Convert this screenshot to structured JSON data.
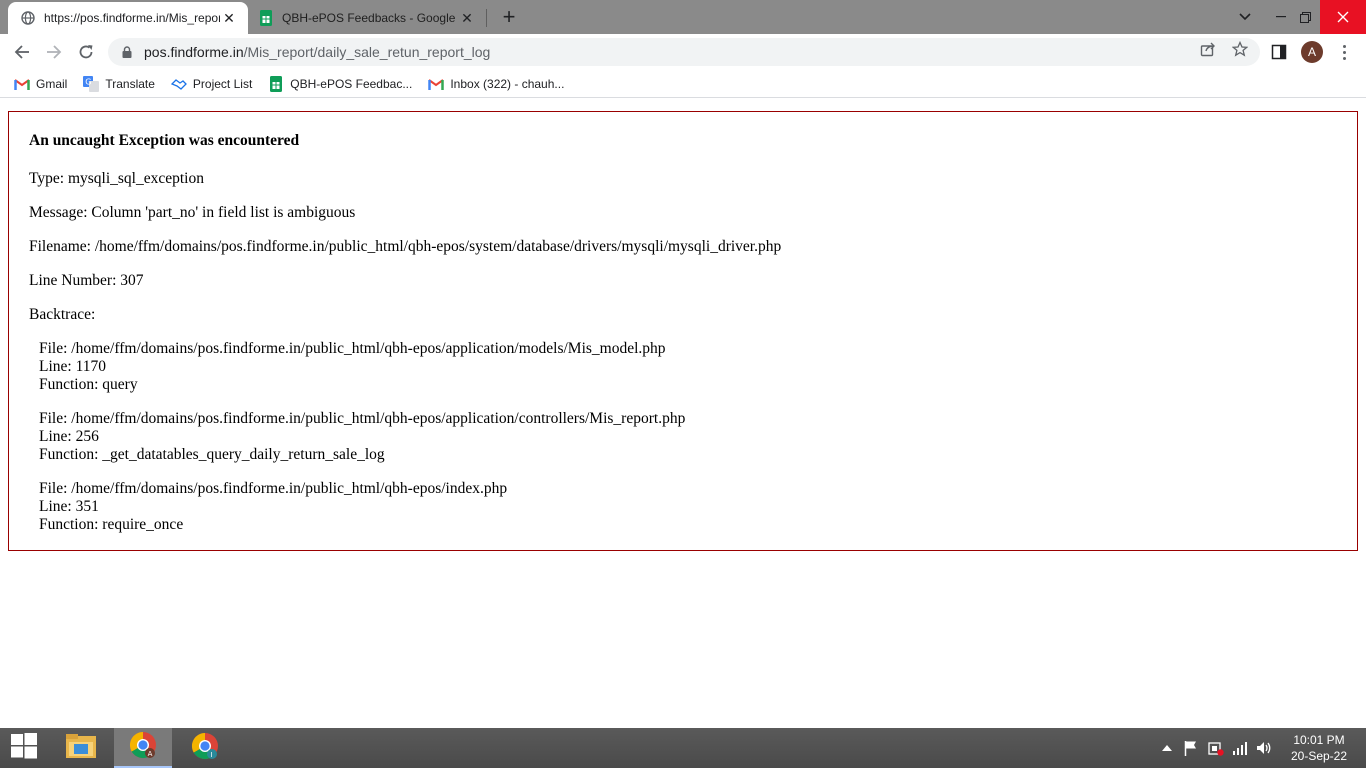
{
  "browser": {
    "tabs": [
      {
        "title": "https://pos.findforme.in/Mis_report/daily_sale_retun_report_log",
        "active": true,
        "favicon": "globe-icon"
      },
      {
        "title": "QBH-ePOS Feedbacks - Google Sheets",
        "active": false,
        "favicon": "google-sheets-icon"
      }
    ],
    "address_bar": {
      "host": "pos.findforme.in",
      "path": "/Mis_report/daily_sale_retun_report_log"
    },
    "profile_initial": "A",
    "bookmarks": [
      {
        "label": "Gmail",
        "icon": "gmail-icon"
      },
      {
        "label": "Translate",
        "icon": "translate-icon"
      },
      {
        "label": "Project List",
        "icon": "handshake-icon"
      },
      {
        "label": "QBH-ePOS Feedbac...",
        "icon": "google-sheets-icon"
      },
      {
        "label": "Inbox (322) - chauh...",
        "icon": "gmail-icon"
      }
    ]
  },
  "error": {
    "heading": "An uncaught Exception was encountered",
    "type": "Type: mysqli_sql_exception",
    "message": "Message: Column 'part_no' in field list is ambiguous",
    "filename": "Filename: /home/ffm/domains/pos.findforme.in/public_html/qbh-epos/system/database/drivers/mysqli/mysqli_driver.php",
    "line_number": "Line Number: 307",
    "backtrace_label": "Backtrace:",
    "backtrace": [
      {
        "file": "File: /home/ffm/domains/pos.findforme.in/public_html/qbh-epos/application/models/Mis_model.php",
        "line": "Line: 1170",
        "function": "Function: query"
      },
      {
        "file": "File: /home/ffm/domains/pos.findforme.in/public_html/qbh-epos/application/controllers/Mis_report.php",
        "line": "Line: 256",
        "function": "Function: _get_datatables_query_daily_return_sale_log"
      },
      {
        "file": "File: /home/ffm/domains/pos.findforme.in/public_html/qbh-epos/index.php",
        "line": "Line: 351",
        "function": "Function: require_once"
      }
    ]
  },
  "taskbar": {
    "time": "10:01 PM",
    "date": "20-Sep-22",
    "apps": [
      {
        "name": "file-explorer-icon"
      },
      {
        "name": "chrome-icon",
        "badge": "A"
      },
      {
        "name": "chrome-icon",
        "badge": "I"
      }
    ]
  },
  "colors": {
    "error_border": "#990000",
    "tabstrip": "#8a8a8a",
    "close_button": "#e81123"
  }
}
